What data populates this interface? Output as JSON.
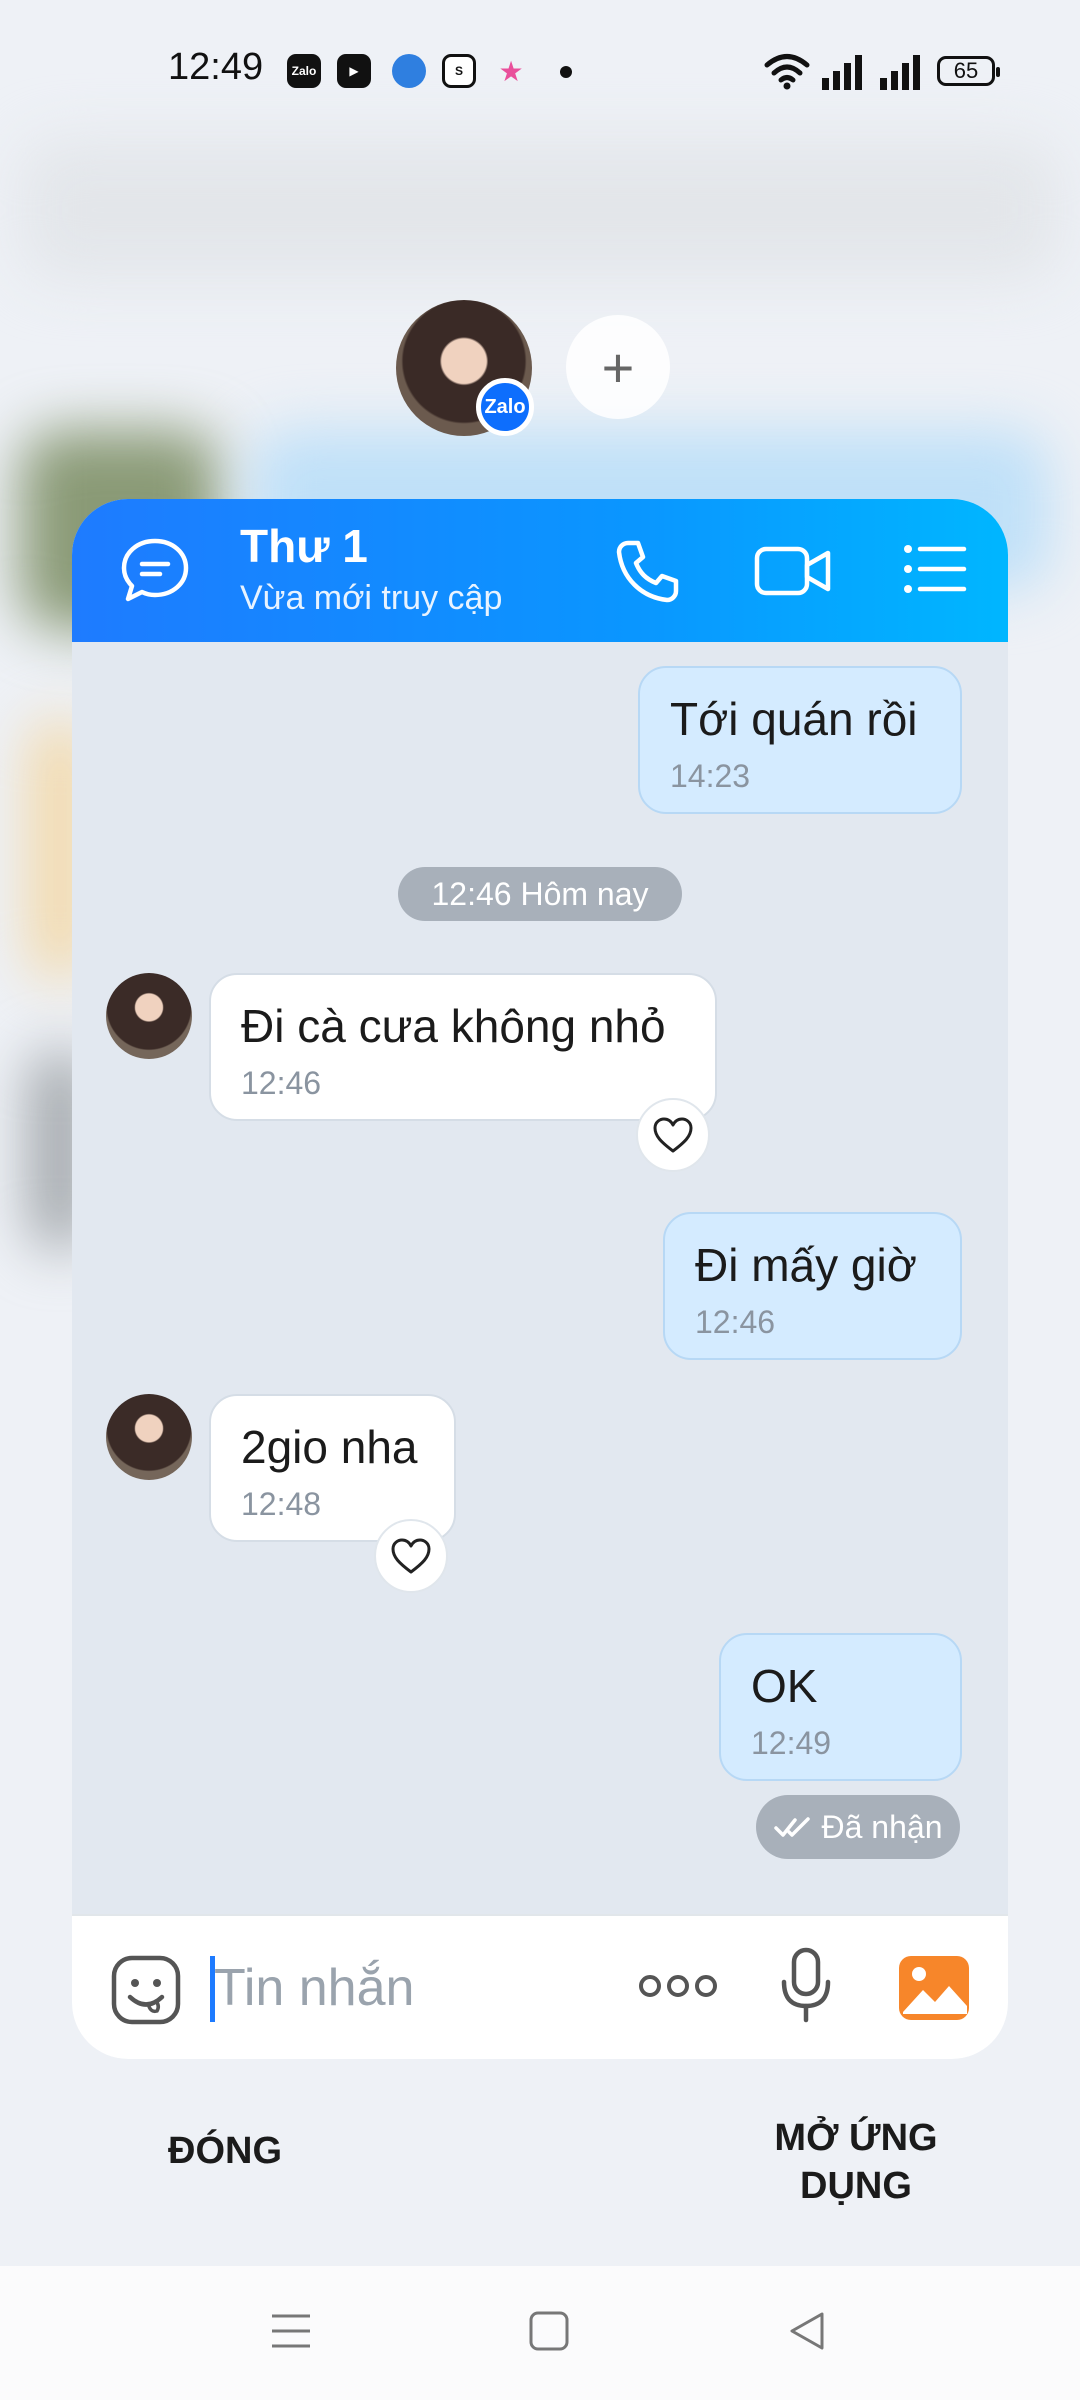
{
  "status_bar": {
    "time": "12:49",
    "battery": "65",
    "apps": [
      "Zalo",
      "Zalo"
    ]
  },
  "bubble_head": {
    "badge": "Zalo",
    "add_label": "+"
  },
  "chat": {
    "contact_name": "Thư 1",
    "contact_status": "Vừa mới truy cập",
    "date_divider": "12:46 Hôm nay",
    "messages": [
      {
        "from": "me",
        "text": "Tới quán rồi",
        "time": "14:23"
      },
      {
        "from": "them",
        "text": "Đi cà cưa không nhỏ",
        "time": "12:46"
      },
      {
        "from": "me",
        "text": "Đi mấy giờ",
        "time": "12:46"
      },
      {
        "from": "them",
        "text": "2gio nha",
        "time": "12:48"
      },
      {
        "from": "me",
        "text": "OK",
        "time": "12:49"
      }
    ],
    "receipt": "Đã nhận",
    "input_placeholder": "Tin nhắn"
  },
  "actions": {
    "close": "ĐÓNG",
    "open_app_line1": "MỞ ỨNG",
    "open_app_line2": "DỤNG"
  },
  "colors": {
    "header_start": "#1e7bff",
    "header_end": "#00b6ff",
    "my_bubble": "#d4ebff",
    "their_bubble": "#ffffff",
    "chat_bg": "#e2e8f0"
  }
}
